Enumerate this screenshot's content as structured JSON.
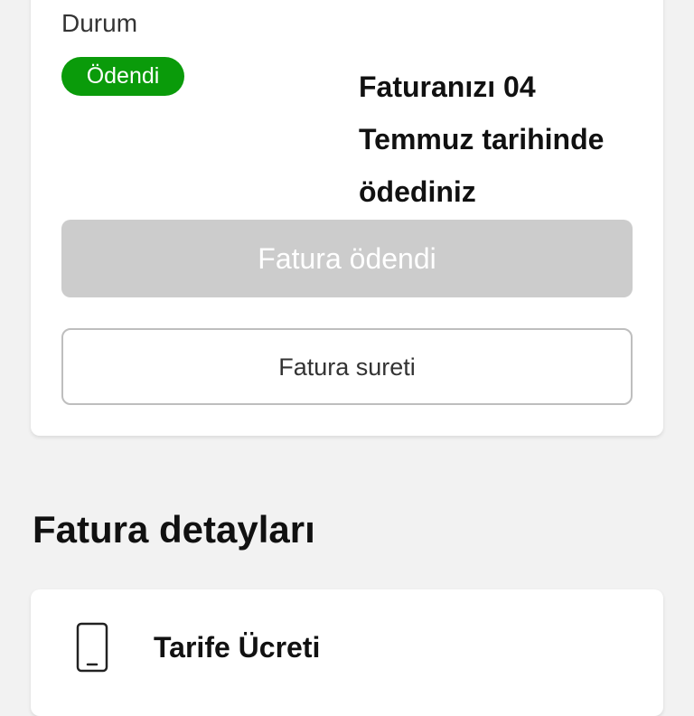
{
  "status_card": {
    "label": "Durum",
    "badge": "Ödendi",
    "message": "Faturanızı 04 Temmuz tarihinde ödediniz",
    "paid_button_label": "Fatura ödendi",
    "invoice_copy_button_label": "Fatura sureti"
  },
  "details": {
    "title": "Fatura detayları",
    "items": [
      {
        "icon": "mobile-phone-icon",
        "label": "Tarife Ücreti"
      }
    ]
  },
  "colors": {
    "badge_green": "#0a9b0a",
    "disabled_button": "#cccccc",
    "background": "#f2f2f2"
  }
}
